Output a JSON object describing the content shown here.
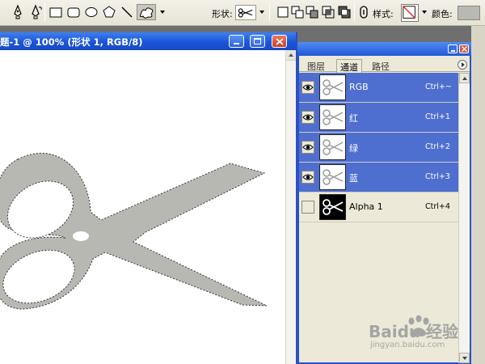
{
  "toolbar": {
    "shape_label": "形状:",
    "style_label": "样式:",
    "color_label": "颜色:",
    "tools": [
      "pen-tool",
      "freeform-pen-tool",
      "rectangle-tool",
      "rounded-rectangle-tool",
      "ellipse-tool",
      "polygon-tool",
      "line-tool",
      "custom-shape-tool"
    ],
    "active_tool": "custom-shape-tool",
    "color_swatch": "#b9b9b4"
  },
  "document": {
    "title": "题-1 @ 100% (形状 1, RGB/8)",
    "shape_fill": "#b7b8b2"
  },
  "palette": {
    "tabs": [
      "图层",
      "通道",
      "路径"
    ],
    "active_tab": "通道",
    "channels": [
      {
        "name": "RGB",
        "shortcut": "Ctrl+~",
        "visible": true,
        "selected": true
      },
      {
        "name": "红",
        "shortcut": "Ctrl+1",
        "visible": true,
        "selected": true
      },
      {
        "name": "绿",
        "shortcut": "Ctrl+2",
        "visible": true,
        "selected": true
      },
      {
        "name": "蓝",
        "shortcut": "Ctrl+3",
        "visible": true,
        "selected": true
      },
      {
        "name": "Alpha 1",
        "shortcut": "Ctrl+4",
        "visible": false,
        "selected": false
      }
    ],
    "selection_color": "#4f6fd0"
  },
  "watermark": {
    "brand": "Baidu 经验",
    "url": "jingyan.baidu.com"
  }
}
